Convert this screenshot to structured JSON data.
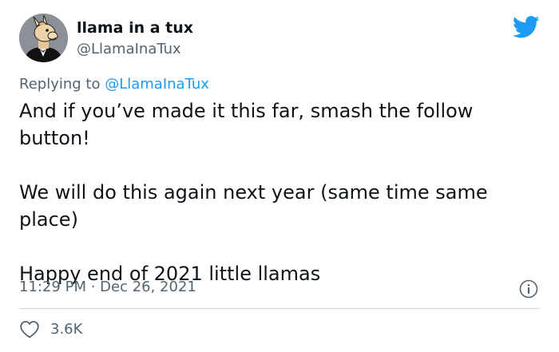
{
  "author": {
    "display_name": "llama in a tux",
    "handle": "@LlamaInaTux",
    "avatar_icon": "llama-in-tux-avatar"
  },
  "reply": {
    "prefix": "Replying to ",
    "mention": "@LlamaInaTux"
  },
  "tweet": {
    "paragraphs": [
      "And if you’ve made it this far, smash the follow button!",
      "We will do this again next year (same time same place)",
      "Happy end of 2021 little llamas"
    ]
  },
  "meta": {
    "timestamp": "11:29 PM · Dec 26, 2021"
  },
  "engagement": {
    "likes": "3.6K"
  },
  "colors": {
    "twitter_blue": "#1d9bf0",
    "text_primary": "#0f1419",
    "text_secondary": "#536471",
    "divider": "#cfd9de"
  }
}
